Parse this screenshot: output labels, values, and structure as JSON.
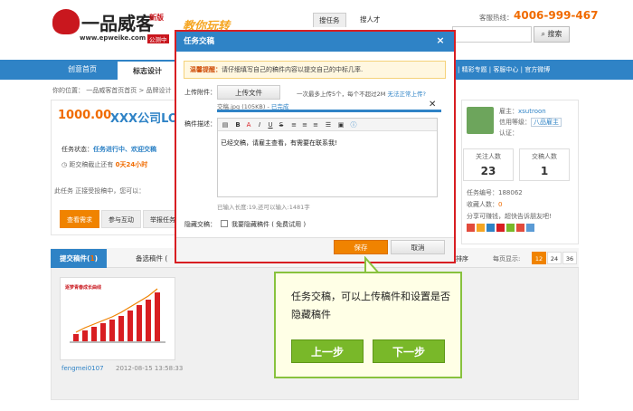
{
  "header": {
    "logo_text": "一品威客",
    "logo_new": "新版",
    "site": "www.epweike.com",
    "site_badge": "公测中",
    "slogan": "教你玩转",
    "search_tabs": [
      "搜任务",
      "搜人才"
    ],
    "search_button": "搜索",
    "hotline_label": "客服热线：",
    "hotline": "4006-999-467"
  },
  "nav": {
    "items": [
      "创意首页",
      "标志设计"
    ],
    "right_links": "| 精彩专题 | 客服中心 | 官方微博"
  },
  "breadcrumb": "你的位置： 一品威客首页首页 > 品牌设计",
  "task": {
    "price": "1000.00",
    "title": "XXX公司LO",
    "state_label": "任务状态：",
    "state_value": "任务进行中、欢迎交稿",
    "deadline_label": "距交稿截止还有",
    "deadline_value": "0天24小时",
    "hint": "此任务 正接受投稿中，您可以：",
    "buttons": [
      "查看需求",
      "参与互动",
      "举报任务"
    ]
  },
  "sidebar": {
    "owner_label": "雇主：",
    "owner_name": "xsutroon",
    "credit_label": "信用等级：",
    "credit_value": "八品雇主",
    "auth_label": "认证：",
    "stats": [
      {
        "label": "关注人数",
        "value": "23"
      },
      {
        "label": "交稿人数",
        "value": "1"
      }
    ],
    "task_no": "任务编号：188062",
    "fav_label": "收藏人数：",
    "fav_value": "0",
    "share": "分享可赚钱，超快告诉朋友吧!"
  },
  "lower": {
    "tabs": [
      {
        "label": "提交稿件(",
        "count": "1",
        "suffix": ")"
      },
      {
        "label": "备选稿件 (",
        "count": "",
        "suffix": ""
      }
    ],
    "sort": "排序",
    "perpage_label": "每页显示:",
    "perpage_options": [
      "12",
      "24",
      "36"
    ],
    "item_title": "逐梦青春成长曲线",
    "item_user": "fengmei0107",
    "item_date": "2012-08-15 13:58:33"
  },
  "modal": {
    "title": "任务交稿",
    "close": "×",
    "tip_label": "温馨提醒：",
    "tip_text": "请仔细填写自己的稿件内容以提交自己的中标几率.",
    "upload_label": "上传附件：",
    "upload_button": "上传文件",
    "upload_note": "一次最多上传5个，每个不超过2M",
    "upload_link": "无法正常上传?",
    "file_name": "交稿.jpg (105KB) - ",
    "file_status": "已完成",
    "desc_label": "稿件描述：",
    "editor_text": "已经交稿，请雇主查看，有需要在联系我!",
    "length_note": "已输入长度:19,还可以输入:1481字",
    "hide_label": "隐藏交稿：",
    "hide_text": "我要隐藏稿件 ( 免费试用 )",
    "save": "保存",
    "cancel": "取消"
  },
  "tutorial": {
    "text": "任务交稿，可以上传稿件和设置是否隐藏稿件",
    "prev": "上一步",
    "next": "下一步"
  }
}
